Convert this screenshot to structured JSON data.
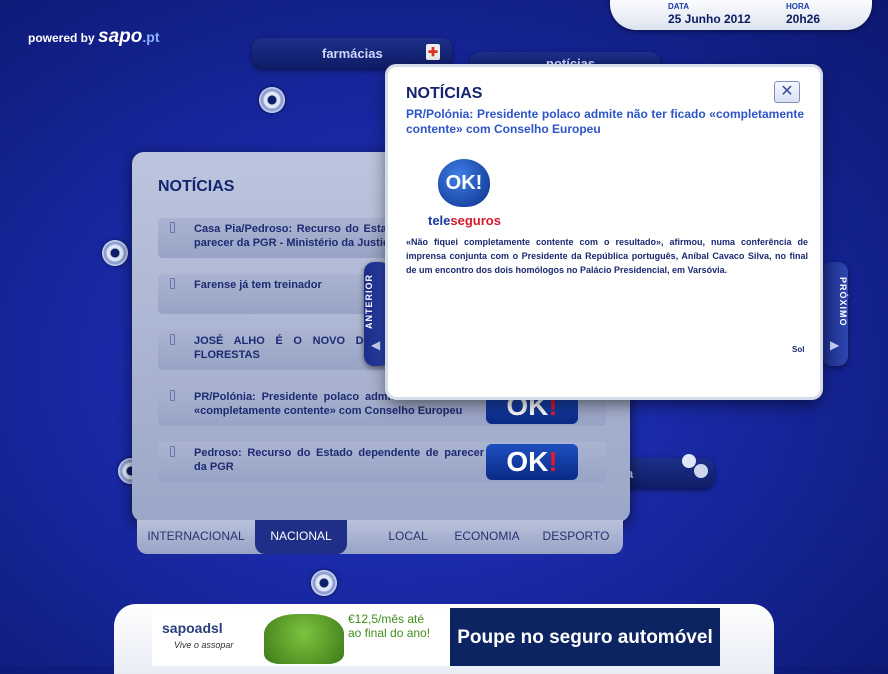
{
  "powered": {
    "prefix": "powered by",
    "brand": "sapo",
    "tld": ".pt"
  },
  "datetime": {
    "date_label": "DATA",
    "date": "25 Junho 2012",
    "time_label": "HORA",
    "time": "20h26"
  },
  "background": {
    "pill_farmacias": "farmácias",
    "pill_noticias_partial": "notícias",
    "pill_right_partial": "a"
  },
  "back_panel": {
    "title": "NOTÍCIAS",
    "items": [
      {
        "text": "Casa Pia/Pedroso: Recurso do Estado dependente de parecer da PGR - Ministério da Justiça"
      },
      {
        "text": "Farense já tem treinador"
      },
      {
        "text": "JOSÉ ALHO É O NOVO DIRECTOR DO ICN - FLORESTAS"
      },
      {
        "text": "PR/Polónia: Presidente polaco admite não ter ficado «completamente contente» com Conselho Europeu"
      },
      {
        "text": "Pedroso: Recurso do Estado dependente de parecer da PGR"
      }
    ],
    "thumb_text": "OK",
    "thumb_excl": "!"
  },
  "tabs": [
    {
      "label": "INTERNACIONAL",
      "active": false
    },
    {
      "label": "NACIONAL",
      "active": true
    },
    {
      "label": "LOCAL",
      "active": false
    },
    {
      "label": "ECONOMIA",
      "active": false
    },
    {
      "label": "DESPORTO",
      "active": false
    }
  ],
  "nav": {
    "prev_label": "ANTERIOR",
    "next_label": "PRÓXIMO"
  },
  "popup": {
    "title": "NOTÍCIAS",
    "headline": "PR/Polónia: Presidente polaco admite não ter ficado «completamente contente» com Conselho Europeu",
    "logo_text": "OK!",
    "logo_brand_a": "tele",
    "logo_brand_b": "seguros",
    "body": "«Não fiquei completamente contente com o resultado», afirmou, numa conferência de imprensa conjunta com o Presidente da República português, Aníbal Cavaco Silva, no final de um encontro dos dois homólogos no Palácio Presidencial, em Varsóvia.",
    "source": "Sol",
    "close_icon": "close-icon"
  },
  "banner": {
    "left_brand": "sapoadsl",
    "left_tagline": "Vive o assopar",
    "left_price": "€12,5/mês até ao final do ano!",
    "right_text": "Poupe no seguro automóvel"
  },
  "colors": {
    "accent": "#2d55c9",
    "dark_blue": "#14246e",
    "ok_red": "#e3192c"
  }
}
